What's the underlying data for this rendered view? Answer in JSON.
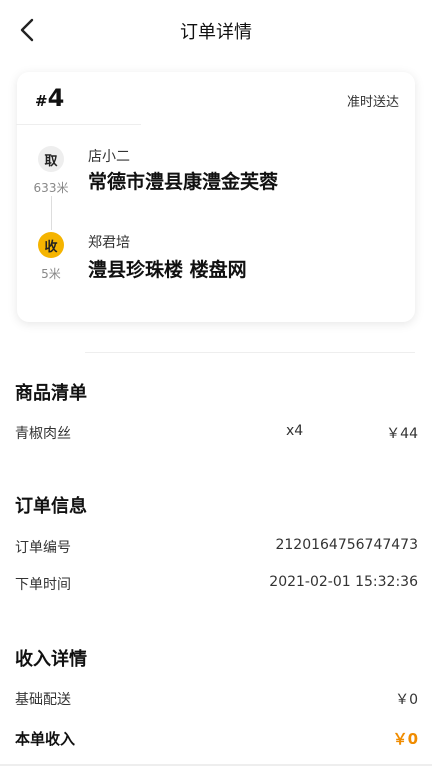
{
  "header": {
    "title": "订单详情"
  },
  "order_card": {
    "hash": "#",
    "number": "4",
    "status": "准时送达",
    "pickup": {
      "badge": "取",
      "distance": "633米",
      "name": "店小二",
      "address": "常德市澧县康澧金芙蓉"
    },
    "dropoff": {
      "badge": "收",
      "distance": "5米",
      "name": "郑君培",
      "address": "澧县珍珠楼 楼盘网"
    }
  },
  "goods": {
    "title": "商品清单",
    "items": [
      {
        "name": "青椒肉丝",
        "qty": "x4",
        "price": "￥44"
      }
    ]
  },
  "order_info": {
    "title": "订单信息",
    "rows": [
      {
        "label": "订单编号",
        "value": "2120164756747473"
      },
      {
        "label": "下单时间",
        "value": "2021-02-01 15:32:36"
      }
    ]
  },
  "income": {
    "title": "收入详情",
    "base_label": "基础配送",
    "base_value": "￥0",
    "total_label": "本单收入",
    "total_value": "￥0"
  },
  "colors": {
    "accent": "#f5b400",
    "income": "#f08c00"
  }
}
